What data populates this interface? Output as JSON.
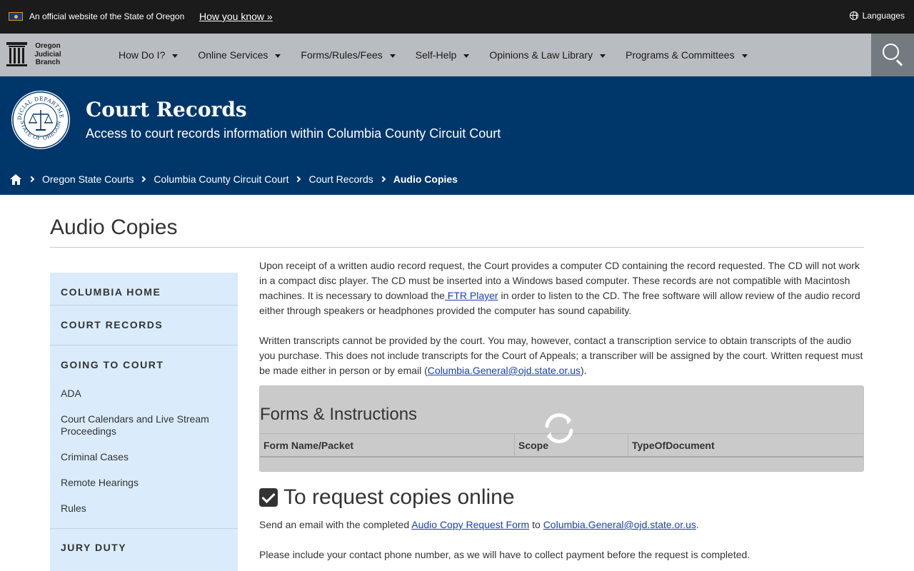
{
  "banner": {
    "official_text": "An official website of the State of Oregon",
    "how_link": "How you know »",
    "languages": "Languages"
  },
  "logo": {
    "line1": "Oregon",
    "line2": "Judicial",
    "line3": "Branch"
  },
  "nav": {
    "items": [
      {
        "label": "How Do I?"
      },
      {
        "label": "Online Services"
      },
      {
        "label": "Forms/Rules/Fees"
      },
      {
        "label": "Self-Help"
      },
      {
        "label": "Opinions & Law Library"
      },
      {
        "label": "Programs & Committees"
      }
    ],
    "search_icon": "search-icon"
  },
  "hero": {
    "title": "Court Records",
    "subtitle": "Access to court records information within Columbia County Circuit Court",
    "seal_text_top": "JUDICIAL DEPARTMENT",
    "seal_text_bottom": "STATE OF OREGON"
  },
  "breadcrumb": {
    "items": [
      "Oregon State Courts",
      "Columbia County Circuit Court",
      "Court Records"
    ],
    "current": "Audio Copies"
  },
  "page": {
    "title": "Audio Copies"
  },
  "sidebar": {
    "home": "COLUMBIA HOME",
    "records": "COURT RECORDS",
    "going": "GOING TO COURT",
    "links": [
      "ADA",
      "Court Calendars and Live Stream Proceedings",
      "Criminal Cases",
      "Remote Hearings",
      "Rules"
    ],
    "jury": "JURY DUTY"
  },
  "content": {
    "p1_a": "Upon receipt of a written audio record request, the Court provides a computer CD containing the record requested. The CD will not work in a compact disc player. The CD must be inserted into a Windows based computer. These records are not compatible with Macintosh machines. It is necessary to download the",
    "p1_link": " FTR Player",
    "p1_b": " in order to listen to the CD. The free software will allow review of the audio record either through speakers or headphones provided the computer has sound capability.",
    "p2_a": "Written transcripts cannot be provided by the court. You may, however, contact a transcription service to obtain transcripts of the audio you purchase. This does not include transcripts for the Court of Appeals; a transcriber will be assigned by the court. Written request must be made either in person or by email (",
    "p2_link": "Columbia.General@ojd.state.or.us",
    "p2_b": ")."
  },
  "forms": {
    "title": "Forms & Instructions",
    "columns": [
      "Form Name/Packet",
      "Scope",
      "TypeOfDocument"
    ]
  },
  "request": {
    "title": "To request copies online",
    "line1_a": "Send an email with the completed ",
    "line1_link1": "Audio Copy Request Form",
    "line1_mid": " to ",
    "line1_link2": "Columbia.General@ojd.state.or.us",
    "line1_end": ".",
    "line2": "Please include your contact phone number, as we will have to collect payment before the request is completed."
  },
  "colors": {
    "banner_bg": "#1b1b1b",
    "nav_bg": "#b9bdc1",
    "hero_bg": "#00376b",
    "sidebar_bg": "#daebfb",
    "link": "#1a3fb0"
  }
}
